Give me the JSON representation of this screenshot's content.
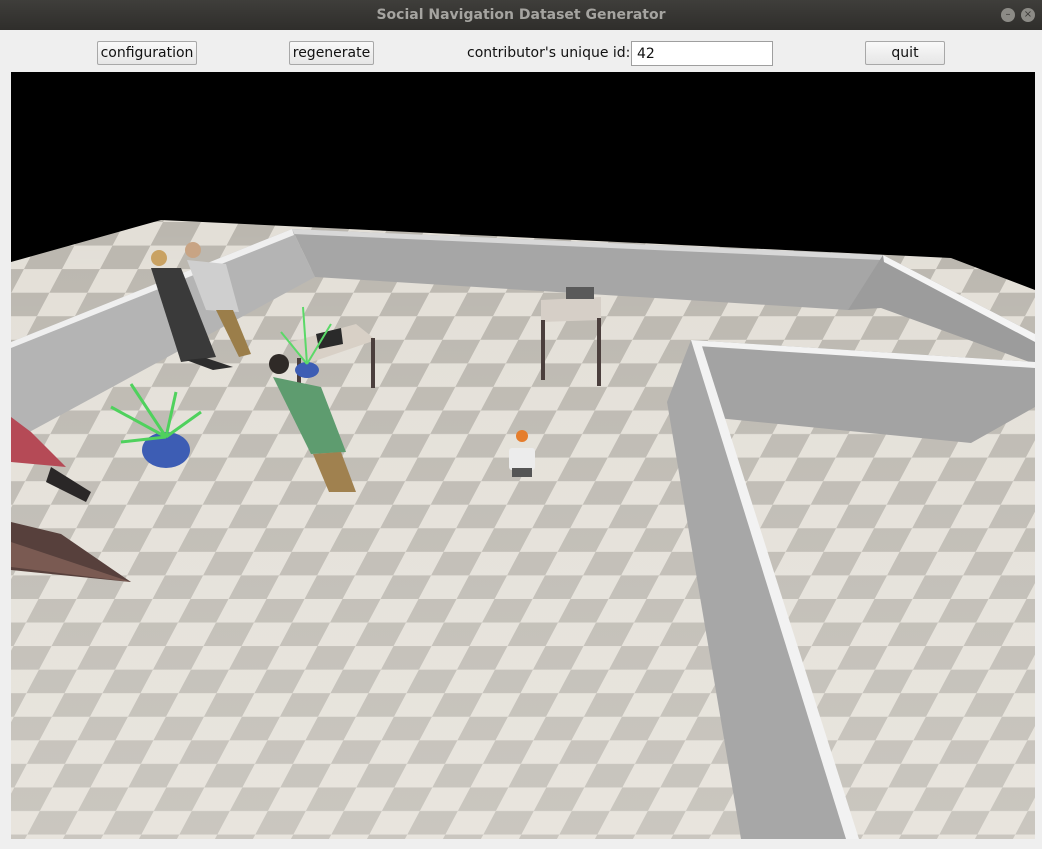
{
  "window": {
    "title": "Social Navigation Dataset Generator",
    "minimize_glyph": "–",
    "close_glyph": "×"
  },
  "toolbar": {
    "configuration_label": "configuration",
    "regenerate_label": "regenerate",
    "id_label": "contributor's unique id:",
    "id_value": "42",
    "quit_label": "quit"
  },
  "scene": {
    "sky_color": "#000000",
    "wall_color": "#a9a9a9",
    "floor_light": "#e4e0d8",
    "floor_dark": "#b9b5ad"
  }
}
